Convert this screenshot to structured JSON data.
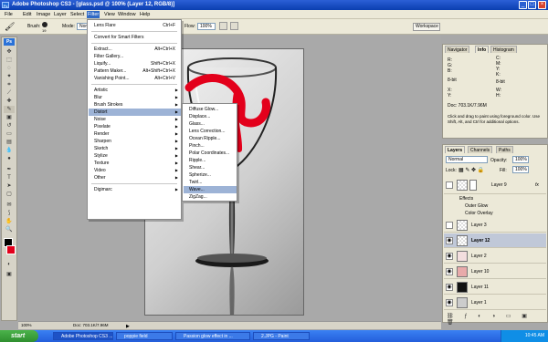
{
  "window": {
    "title": "Adobe Photoshop CS3 - [glass.psd @ 100% (Layer 12, RGB/8)]",
    "app_icon": "Ps"
  },
  "menubar": {
    "items": [
      "File",
      "Edit",
      "Image",
      "Layer",
      "Select",
      "Filter",
      "View",
      "Window",
      "Help"
    ]
  },
  "options": {
    "brush_label": "Brush:",
    "brush_size": "19",
    "mode_label": "Mode:",
    "mode_value": "Normal",
    "flow_label": "Flow:",
    "flow_value": "100%",
    "workspace": "Workspace"
  },
  "filter_menu": {
    "lens_flare": "Lens Flare",
    "lens_flare_sc": "Ctrl+F",
    "convert": "Convert for Smart Filters",
    "extract": "Extract...",
    "extract_sc": "Alt+Ctrl+X",
    "gallery": "Filter Gallery...",
    "liquify": "Liquify...",
    "liquify_sc": "Shift+Ctrl+X",
    "pattern": "Pattern Maker...",
    "pattern_sc": "Alt+Shift+Ctrl+X",
    "vanishing": "Vanishing Point...",
    "vanishing_sc": "Alt+Ctrl+V",
    "artistic": "Artistic",
    "blur": "Blur",
    "brush_strokes": "Brush Strokes",
    "distort": "Distort",
    "noise": "Noise",
    "pixelate": "Pixelate",
    "render": "Render",
    "sharpen": "Sharpen",
    "sketch": "Sketch",
    "stylize": "Stylize",
    "texture": "Texture",
    "video": "Video",
    "other": "Other",
    "digimarc": "Digimarc"
  },
  "distort_submenu": {
    "items": [
      "Diffuse Glow...",
      "Displace...",
      "Glass...",
      "Lens Correction...",
      "Ocean Ripple...",
      "Pinch...",
      "Polar Coordinates...",
      "Ripple...",
      "Shear...",
      "Spherize...",
      "Twirl...",
      "Wave...",
      "ZigZag..."
    ],
    "highlighted": "Wave..."
  },
  "info_panel": {
    "tabs": [
      "Navigator",
      "Info",
      "Histogram"
    ],
    "r_label": "R:",
    "g_label": "G:",
    "b_label": "B:",
    "c_label": "C:",
    "m_label": "M:",
    "y_label": "Y:",
    "k_label": "K:",
    "bit_left": "8-bit",
    "bit_right": "8-bit",
    "x_label": "X:",
    "y2_label": "Y:",
    "w_label": "W:",
    "h_label": "H:",
    "doc": "Doc: 703.1K/7.96M",
    "hint": "Click and drag to paint using foreground color. Use Shift, Alt, and Ctrl for additional options."
  },
  "layers_panel": {
    "tabs": [
      "Layers",
      "Channels",
      "Paths"
    ],
    "blend": "Normal",
    "opacity_label": "Opacity:",
    "opacity": "100%",
    "lock_label": "Lock:",
    "fill_label": "Fill:",
    "fill": "100%",
    "layer9": "Layer 9",
    "effects": "Effects",
    "outer_glow": "Outer Glow",
    "color_overlay": "Color Overlay",
    "layer3": "Layer 3",
    "layer12": "Layer 12",
    "layer2": "Layer 2",
    "layer10": "Layer 10",
    "layer11": "Layer 11",
    "layer1": "Layer 1"
  },
  "status": {
    "zoom": "100%",
    "doc": "Doc: 703.1K/7.96M"
  },
  "taskbar": {
    "start": "start",
    "tasks": [
      "Adobe Photoshop CS3 ...",
      "poppie field",
      "Passion glow effect in ...",
      "2.JPG - Paint"
    ],
    "time": "10:45 AM"
  },
  "colors": {
    "accent": "#316ac5",
    "highlight": "#9db3d6",
    "stroke": "#e3001b"
  }
}
